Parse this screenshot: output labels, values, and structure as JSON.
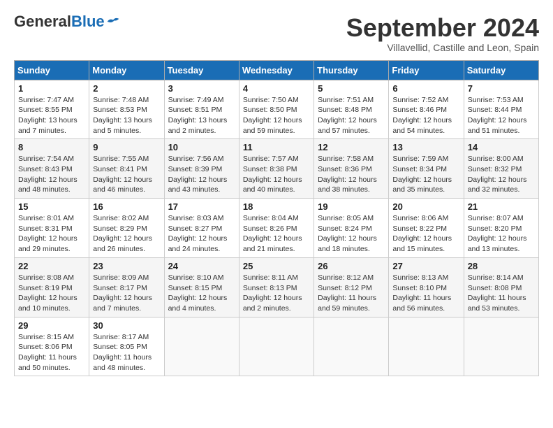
{
  "header": {
    "logo_general": "General",
    "logo_blue": "Blue",
    "month_title": "September 2024",
    "location": "Villavellid, Castille and Leon, Spain"
  },
  "weekdays": [
    "Sunday",
    "Monday",
    "Tuesday",
    "Wednesday",
    "Thursday",
    "Friday",
    "Saturday"
  ],
  "weeks": [
    [
      {
        "day": "1",
        "sunrise": "Sunrise: 7:47 AM",
        "sunset": "Sunset: 8:55 PM",
        "daylight": "Daylight: 13 hours and 7 minutes."
      },
      {
        "day": "2",
        "sunrise": "Sunrise: 7:48 AM",
        "sunset": "Sunset: 8:53 PM",
        "daylight": "Daylight: 13 hours and 5 minutes."
      },
      {
        "day": "3",
        "sunrise": "Sunrise: 7:49 AM",
        "sunset": "Sunset: 8:51 PM",
        "daylight": "Daylight: 13 hours and 2 minutes."
      },
      {
        "day": "4",
        "sunrise": "Sunrise: 7:50 AM",
        "sunset": "Sunset: 8:50 PM",
        "daylight": "Daylight: 12 hours and 59 minutes."
      },
      {
        "day": "5",
        "sunrise": "Sunrise: 7:51 AM",
        "sunset": "Sunset: 8:48 PM",
        "daylight": "Daylight: 12 hours and 57 minutes."
      },
      {
        "day": "6",
        "sunrise": "Sunrise: 7:52 AM",
        "sunset": "Sunset: 8:46 PM",
        "daylight": "Daylight: 12 hours and 54 minutes."
      },
      {
        "day": "7",
        "sunrise": "Sunrise: 7:53 AM",
        "sunset": "Sunset: 8:44 PM",
        "daylight": "Daylight: 12 hours and 51 minutes."
      }
    ],
    [
      {
        "day": "8",
        "sunrise": "Sunrise: 7:54 AM",
        "sunset": "Sunset: 8:43 PM",
        "daylight": "Daylight: 12 hours and 48 minutes."
      },
      {
        "day": "9",
        "sunrise": "Sunrise: 7:55 AM",
        "sunset": "Sunset: 8:41 PM",
        "daylight": "Daylight: 12 hours and 46 minutes."
      },
      {
        "day": "10",
        "sunrise": "Sunrise: 7:56 AM",
        "sunset": "Sunset: 8:39 PM",
        "daylight": "Daylight: 12 hours and 43 minutes."
      },
      {
        "day": "11",
        "sunrise": "Sunrise: 7:57 AM",
        "sunset": "Sunset: 8:38 PM",
        "daylight": "Daylight: 12 hours and 40 minutes."
      },
      {
        "day": "12",
        "sunrise": "Sunrise: 7:58 AM",
        "sunset": "Sunset: 8:36 PM",
        "daylight": "Daylight: 12 hours and 38 minutes."
      },
      {
        "day": "13",
        "sunrise": "Sunrise: 7:59 AM",
        "sunset": "Sunset: 8:34 PM",
        "daylight": "Daylight: 12 hours and 35 minutes."
      },
      {
        "day": "14",
        "sunrise": "Sunrise: 8:00 AM",
        "sunset": "Sunset: 8:32 PM",
        "daylight": "Daylight: 12 hours and 32 minutes."
      }
    ],
    [
      {
        "day": "15",
        "sunrise": "Sunrise: 8:01 AM",
        "sunset": "Sunset: 8:31 PM",
        "daylight": "Daylight: 12 hours and 29 minutes."
      },
      {
        "day": "16",
        "sunrise": "Sunrise: 8:02 AM",
        "sunset": "Sunset: 8:29 PM",
        "daylight": "Daylight: 12 hours and 26 minutes."
      },
      {
        "day": "17",
        "sunrise": "Sunrise: 8:03 AM",
        "sunset": "Sunset: 8:27 PM",
        "daylight": "Daylight: 12 hours and 24 minutes."
      },
      {
        "day": "18",
        "sunrise": "Sunrise: 8:04 AM",
        "sunset": "Sunset: 8:26 PM",
        "daylight": "Daylight: 12 hours and 21 minutes."
      },
      {
        "day": "19",
        "sunrise": "Sunrise: 8:05 AM",
        "sunset": "Sunset: 8:24 PM",
        "daylight": "Daylight: 12 hours and 18 minutes."
      },
      {
        "day": "20",
        "sunrise": "Sunrise: 8:06 AM",
        "sunset": "Sunset: 8:22 PM",
        "daylight": "Daylight: 12 hours and 15 minutes."
      },
      {
        "day": "21",
        "sunrise": "Sunrise: 8:07 AM",
        "sunset": "Sunset: 8:20 PM",
        "daylight": "Daylight: 12 hours and 13 minutes."
      }
    ],
    [
      {
        "day": "22",
        "sunrise": "Sunrise: 8:08 AM",
        "sunset": "Sunset: 8:19 PM",
        "daylight": "Daylight: 12 hours and 10 minutes."
      },
      {
        "day": "23",
        "sunrise": "Sunrise: 8:09 AM",
        "sunset": "Sunset: 8:17 PM",
        "daylight": "Daylight: 12 hours and 7 minutes."
      },
      {
        "day": "24",
        "sunrise": "Sunrise: 8:10 AM",
        "sunset": "Sunset: 8:15 PM",
        "daylight": "Daylight: 12 hours and 4 minutes."
      },
      {
        "day": "25",
        "sunrise": "Sunrise: 8:11 AM",
        "sunset": "Sunset: 8:13 PM",
        "daylight": "Daylight: 12 hours and 2 minutes."
      },
      {
        "day": "26",
        "sunrise": "Sunrise: 8:12 AM",
        "sunset": "Sunset: 8:12 PM",
        "daylight": "Daylight: 11 hours and 59 minutes."
      },
      {
        "day": "27",
        "sunrise": "Sunrise: 8:13 AM",
        "sunset": "Sunset: 8:10 PM",
        "daylight": "Daylight: 11 hours and 56 minutes."
      },
      {
        "day": "28",
        "sunrise": "Sunrise: 8:14 AM",
        "sunset": "Sunset: 8:08 PM",
        "daylight": "Daylight: 11 hours and 53 minutes."
      }
    ],
    [
      {
        "day": "29",
        "sunrise": "Sunrise: 8:15 AM",
        "sunset": "Sunset: 8:06 PM",
        "daylight": "Daylight: 11 hours and 50 minutes."
      },
      {
        "day": "30",
        "sunrise": "Sunrise: 8:17 AM",
        "sunset": "Sunset: 8:05 PM",
        "daylight": "Daylight: 11 hours and 48 minutes."
      },
      null,
      null,
      null,
      null,
      null
    ]
  ]
}
